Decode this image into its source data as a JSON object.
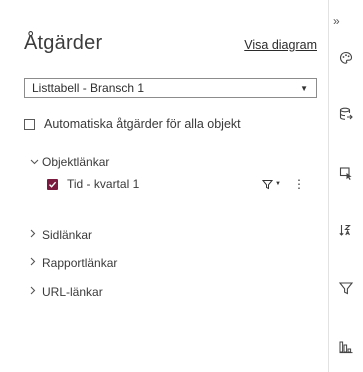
{
  "panel": {
    "title": "Åtgärder",
    "diagram_link": "Visa diagram",
    "select": {
      "value": "Listtabell - Bransch 1"
    },
    "auto_actions_label": "Automatiska åtgärder för alla objekt",
    "auto_actions_checked": false
  },
  "tree": {
    "object_links": {
      "label": "Objektlänkar",
      "expanded": true,
      "child": {
        "label": "Tid - kvartal 1",
        "checked": true
      }
    },
    "page_links": {
      "label": "Sidlänkar"
    },
    "report_links": {
      "label": "Rapportlänkar"
    },
    "url_links": {
      "label": "URL-länkar"
    }
  },
  "rail": {
    "collapse_glyph": "»",
    "items": [
      "palette-icon",
      "data-icon",
      "actions-icon",
      "ranks-icon",
      "filter-icon",
      "chart-icon"
    ]
  },
  "colors": {
    "accent": "#7a1a3e",
    "border": "#e2e2e2"
  }
}
